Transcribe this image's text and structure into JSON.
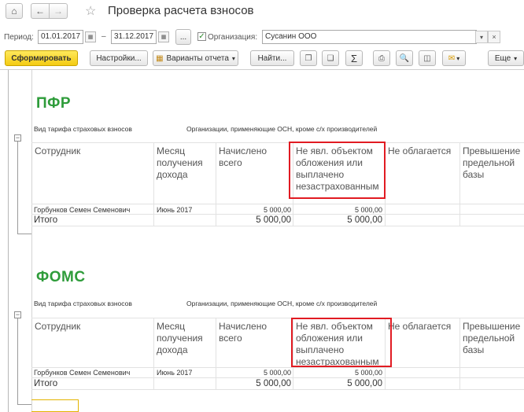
{
  "window": {
    "title": "Проверка расчета взносов"
  },
  "filters": {
    "period_label": "Период:",
    "date_from": "01.01.2017",
    "dash": "–",
    "date_to": "31.12.2017",
    "ellipsis": "...",
    "org_label": "Организация:",
    "org_value": "Сусанин ООО"
  },
  "toolbar": {
    "generate_label": "Сформировать",
    "settings_label": "Настройки...",
    "variants_label": "Варианты отчета",
    "find_label": "Найти...",
    "sum_label": "Σ",
    "more_label": "Еще"
  },
  "report": {
    "sections": [
      {
        "title": "ПФР",
        "tariff_label": "Вид тарифа страховых взносов",
        "tariff_value": "Организации, применяющие ОСН, кроме с/х производителей",
        "headers": [
          "Сотрудник",
          "Месяц получения дохода",
          "Начислено всего",
          "Не явл. объектом обложения или выплачено незастрахованным",
          "Не облагается",
          "Превышение предельной базы"
        ],
        "row": {
          "employee": "Горбунков Семен Семенович",
          "month": "Июнь 2017",
          "accrued": "5 000,00",
          "non_object": "5 000,00"
        },
        "total": {
          "label": "Итого",
          "accrued": "5 000,00",
          "non_object": "5 000,00"
        }
      },
      {
        "title": "ФОМС",
        "tariff_label": "Вид тарифа страховых взносов",
        "tariff_value": "Организации, применяющие ОСН, кроме с/х производителей",
        "headers": [
          "Сотрудник",
          "Месяц получения дохода",
          "Начислено всего",
          "Не явл. объектом обложения или выплачено незастрахованным",
          "Не облагается",
          "Превышение предельной базы"
        ],
        "row": {
          "employee": "Горбунков Семен Семенович",
          "month": "Июнь 2017",
          "accrued": "5 000,00",
          "non_object": "5 000,00"
        },
        "total": {
          "label": "Итого",
          "accrued": "5 000,00",
          "non_object": "5 000,00"
        }
      }
    ]
  },
  "icons": {
    "home": "home-icon",
    "back": "arrow-left-icon",
    "forward": "arrow-right-icon",
    "favorite": "star-icon",
    "calendar": "calendar-icon",
    "dropdown": "chevron-down-icon",
    "clear": "close-icon",
    "copy": "copy-icon",
    "print": "printer-icon",
    "preview": "preview-icon",
    "save": "floppy-icon",
    "mail": "envelope-icon"
  },
  "colors": {
    "accent_green": "#2e9c3a",
    "highlight_red": "#e11b22",
    "primary_button": "#f4cb13"
  }
}
